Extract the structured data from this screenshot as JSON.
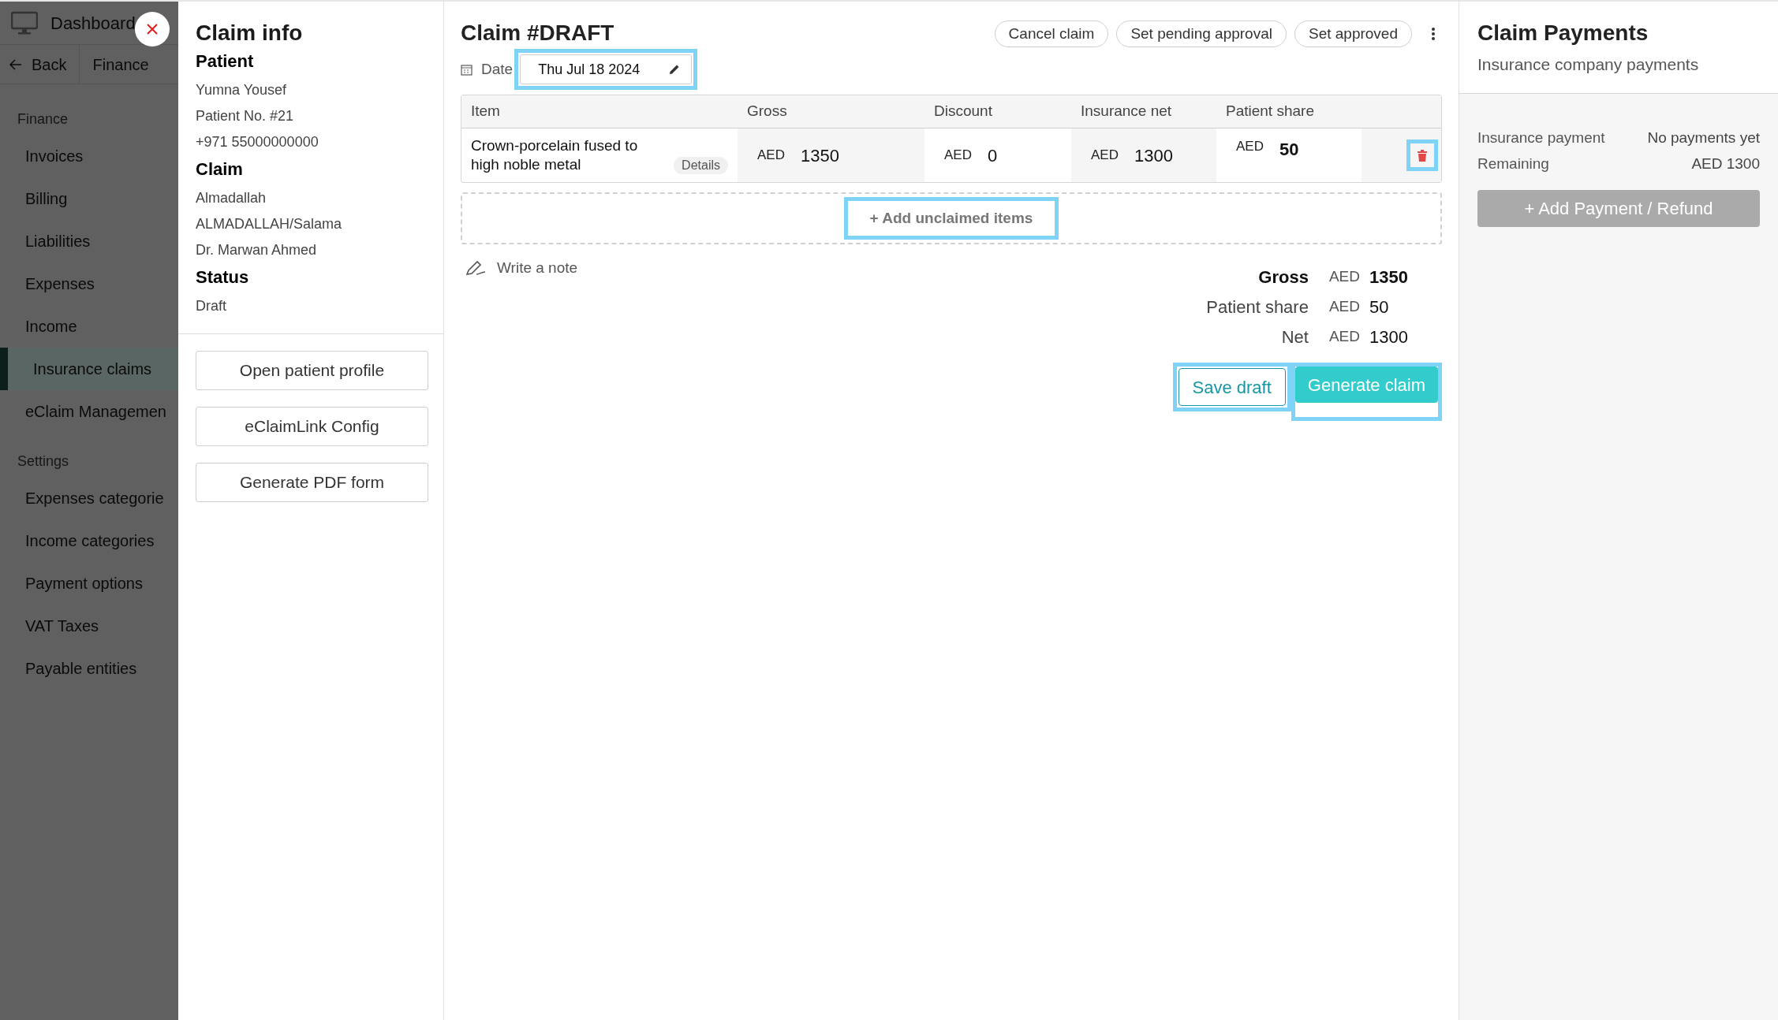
{
  "sidebar": {
    "top_link": "Dashboard",
    "back": "Back",
    "breadcrumb": "Finance",
    "sections": [
      {
        "title": "Finance",
        "items": [
          {
            "label": "Invoices",
            "selected": false
          },
          {
            "label": "Billing",
            "selected": false
          },
          {
            "label": "Liabilities",
            "selected": false
          },
          {
            "label": "Expenses",
            "selected": false
          },
          {
            "label": "Income",
            "selected": false
          },
          {
            "label": "Insurance claims",
            "selected": true
          },
          {
            "label": "eClaim Managemen",
            "selected": false
          }
        ]
      },
      {
        "title": "Settings",
        "items": [
          {
            "label": "Expenses categorie",
            "selected": false
          },
          {
            "label": "Income categories",
            "selected": false
          },
          {
            "label": "Payment options",
            "selected": false
          },
          {
            "label": "VAT Taxes",
            "selected": false
          },
          {
            "label": "Payable entities",
            "selected": false
          }
        ]
      }
    ]
  },
  "claim_info": {
    "title": "Claim info",
    "groups": [
      {
        "heading": "Patient",
        "lines": [
          "Yumna Yousef",
          "Patient No. #21",
          "+971 55000000000"
        ]
      },
      {
        "heading": "Claim",
        "lines": [
          "Almadallah",
          "ALMADALLAH/Salama",
          "Dr. Marwan Ahmed"
        ]
      },
      {
        "heading": "Status",
        "lines": [
          "Draft"
        ]
      }
    ],
    "buttons": [
      "Open patient profile",
      "eClaimLink Config",
      "Generate PDF form"
    ]
  },
  "claim": {
    "title": "Claim #DRAFT",
    "actions": [
      "Cancel claim",
      "Set pending approval",
      "Set approved"
    ],
    "date_label": "Date",
    "date": {
      "value": "Thu Jul 18 2024",
      "highlighted": true
    },
    "table": {
      "columns": [
        "Item",
        "Gross",
        "Discount",
        "Insurance net",
        "Patient share"
      ],
      "rows": [
        {
          "cells": [
            {
              "text": "Crown-porcelain fused to high noble metal",
              "details": "Details"
            },
            {
              "currency": "AED",
              "value": "1350",
              "bold": false
            },
            {
              "currency": "AED",
              "value": "0",
              "bold": false
            },
            {
              "currency": "AED",
              "value": "1300",
              "bold": false
            },
            {
              "currency": "AED",
              "value": "50",
              "bold": true
            }
          ],
          "delete_highlighted": true
        }
      ]
    },
    "add_items": {
      "label": "+ Add unclaimed items",
      "highlighted": true
    },
    "note": "Write a note",
    "summary": [
      {
        "label": "Gross",
        "currency": "AED",
        "value": "1350",
        "bold": true
      },
      {
        "label": "Patient share",
        "currency": "AED",
        "value": "50",
        "bold": false
      },
      {
        "label": "Net",
        "currency": "AED",
        "value": "1300",
        "bold": false
      }
    ],
    "save": {
      "label": "Save draft",
      "highlighted": true
    },
    "generate": {
      "label": "Generate claim",
      "highlighted": true
    }
  },
  "payments": {
    "title": "Claim Payments",
    "subtitle": "Insurance company payments",
    "rows": [
      {
        "label": "Insurance payment",
        "value": "No payments yet"
      },
      {
        "label": "Remaining",
        "value": "AED 1300"
      }
    ],
    "add_button": "+ Add Payment / Refund"
  }
}
